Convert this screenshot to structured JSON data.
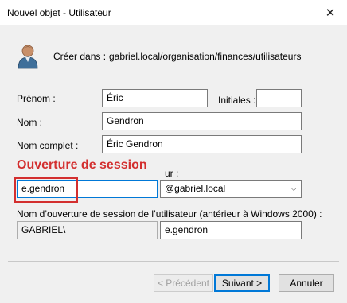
{
  "window": {
    "title": "Nouvel objet - Utilisateur",
    "close_glyph": "✕"
  },
  "header": {
    "icon": "user-icon",
    "create_in_label": "Créer dans :",
    "create_in_path": "gabriel.local/organisation/finances/utilisateurs"
  },
  "form": {
    "first_name_label": "Prénom :",
    "first_name_value": "Éric",
    "initials_label": "Initiales :",
    "initials_value": "",
    "last_name_label": "Nom :",
    "last_name_value": "Gendron",
    "full_name_label": "Nom complet :",
    "full_name_value": "Éric Gendron",
    "logon_label_tail": "ur :",
    "logon_value": "e.gendron",
    "domain_value": "@gabriel.local",
    "pre2000_label": "Nom d’ouverture de session de l’utilisateur (antérieur à Windows 2000) :",
    "pre2000_domain": "GABRIEL\\",
    "pre2000_value": "e.gendron"
  },
  "annotation": {
    "text": "Ouverture de session",
    "color": "#d32f2f"
  },
  "buttons": {
    "previous": "< Précédent",
    "next": "Suivant >",
    "cancel": "Annuler"
  }
}
